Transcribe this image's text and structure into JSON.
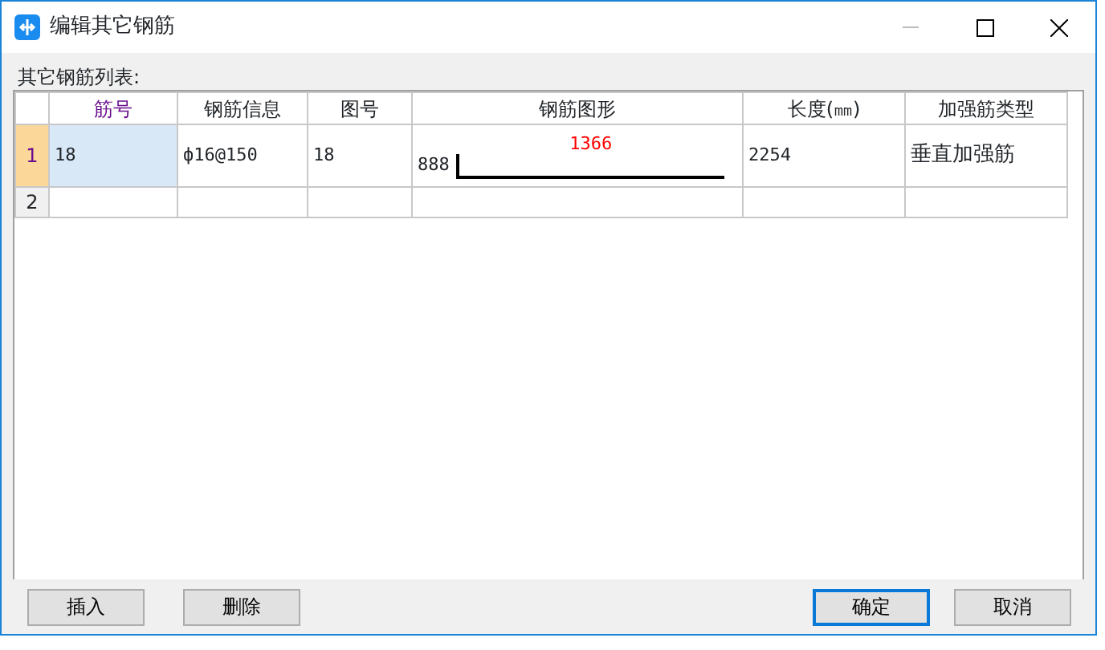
{
  "window": {
    "title": "编辑其它钢筋"
  },
  "list_label": "其它钢筋列表:",
  "table": {
    "columns": [
      {
        "label": "筋号",
        "selected": true
      },
      {
        "label": "钢筋信息",
        "selected": false
      },
      {
        "label": "图号",
        "selected": false
      },
      {
        "label": "钢筋图形",
        "selected": false
      },
      {
        "label": "长度(㎜)",
        "selected": false
      },
      {
        "label": "加强筋类型",
        "selected": false
      }
    ],
    "rows": [
      {
        "number": "1",
        "selected": true,
        "bar_id": "18",
        "bar_info": "ф16@150",
        "figure_no": "18",
        "shape": {
          "left_dim": "888",
          "top_dim": "1366"
        },
        "length": "2254",
        "type": "垂直加强筋"
      },
      {
        "number": "2",
        "selected": false
      }
    ]
  },
  "buttons": [
    {
      "label": "插入",
      "default": false
    },
    {
      "label": "删除",
      "default": false
    },
    {
      "label": "确定",
      "default": true
    },
    {
      "label": "取消",
      "default": false
    }
  ]
}
